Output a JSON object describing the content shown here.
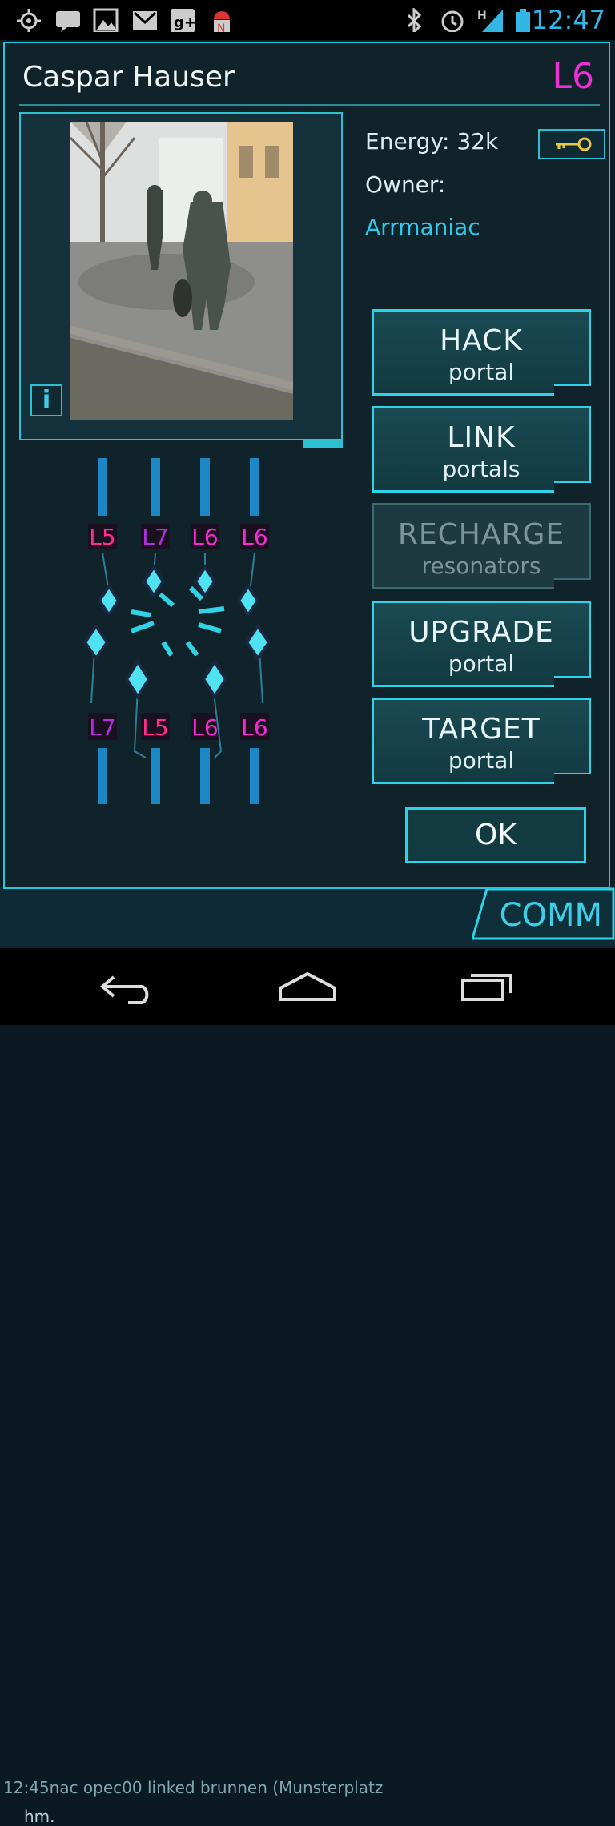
{
  "status_bar": {
    "time": "12:47",
    "icons": [
      "gps-icon",
      "chat-icon",
      "image-icon",
      "gmail-icon",
      "google-plus-icon",
      "android-icon",
      "bluetooth-icon",
      "alarm-icon",
      "signal-icon",
      "battery-icon"
    ]
  },
  "portal": {
    "title": "Caspar Hauser",
    "level": "L6",
    "energy_label": "Energy:",
    "energy_value": "32k",
    "owner_label": "Owner:",
    "owner_name": "Arrmaniac",
    "info_label": "i"
  },
  "actions": [
    {
      "main": "HACK",
      "sub": "portal",
      "enabled": true
    },
    {
      "main": "LINK",
      "sub": "portals",
      "enabled": true
    },
    {
      "main": "RECHARGE",
      "sub": "resonators",
      "enabled": false
    },
    {
      "main": "UPGRADE",
      "sub": "portal",
      "enabled": true
    },
    {
      "main": "TARGET",
      "sub": "portal",
      "enabled": true
    }
  ],
  "ok_label": "OK",
  "resonators": {
    "top": [
      "L5",
      "L7",
      "L6",
      "L6"
    ],
    "bottom": [
      "L7",
      "L5",
      "L6",
      "L6"
    ]
  },
  "comm": {
    "label": "COMM",
    "line1": "12:45nac  opec00 linked brunnen (Munsterplatz",
    "line2": "hm."
  },
  "colors": {
    "accent": "#2fd2e6",
    "level_magenta": "#ec2fd6",
    "owner_cyan": "#2ec8ea",
    "L5": "#ff2e8a",
    "L6": "#f02ed0",
    "L7": "#b12fe0"
  }
}
